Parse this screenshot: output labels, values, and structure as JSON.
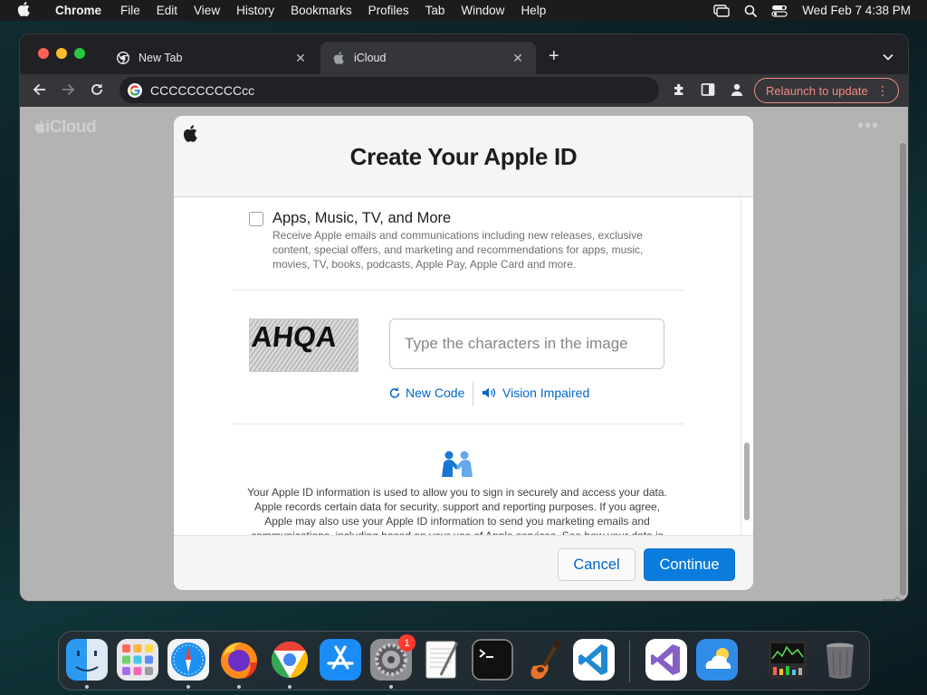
{
  "menubar": {
    "app": "Chrome",
    "items": [
      "File",
      "Edit",
      "View",
      "History",
      "Bookmarks",
      "Profiles",
      "Tab",
      "Window",
      "Help"
    ],
    "clock": "Wed Feb 7  4:38 PM"
  },
  "browser": {
    "tabs": [
      {
        "title": "New Tab"
      },
      {
        "title": "iCloud"
      }
    ],
    "url": "CCCCCCCCCCcc",
    "relaunch_label": "Relaunch to update"
  },
  "page": {
    "logo": "iCloud"
  },
  "modal": {
    "title": "Create Your Apple ID",
    "option": {
      "label": "Apps, Music, TV, and More",
      "description": "Receive Apple emails and communications including new releases, exclusive content, special offers, and marketing and recommendations for apps, music, movies, TV, books, podcasts, Apple Pay, Apple Card and more.",
      "checked": false
    },
    "captcha": {
      "image_text": "AHQA",
      "placeholder": "Type the characters in the image",
      "value": "",
      "new_code_label": "New Code",
      "vision_impaired_label": "Vision Impaired"
    },
    "privacy_text": "Your Apple ID information is used to allow you to sign in securely and access your data. Apple records certain data for security, support and reporting purposes. If you agree, Apple may also use your Apple ID information to send you marketing emails and communications, including based on your use of Apple services. See how your data is managed.",
    "buttons": {
      "cancel": "Cancel",
      "continue": "Continue"
    }
  },
  "dock": {
    "apps": [
      "finder-icon",
      "launchpad-icon",
      "safari-icon",
      "firefox-icon",
      "chrome-icon",
      "app-store-icon",
      "system-settings-icon",
      "textedit-icon",
      "terminal-icon",
      "garageband-icon",
      "vscode-icon",
      "visual-studio-icon",
      "weather-icon",
      "activity-monitor-icon",
      "trash-icon"
    ],
    "settings_badge": "1"
  },
  "colors": {
    "accent": "#0066cc",
    "button_primary": "#0a7cde",
    "relaunch": "#f28b82",
    "badge": "#ff3b30"
  }
}
